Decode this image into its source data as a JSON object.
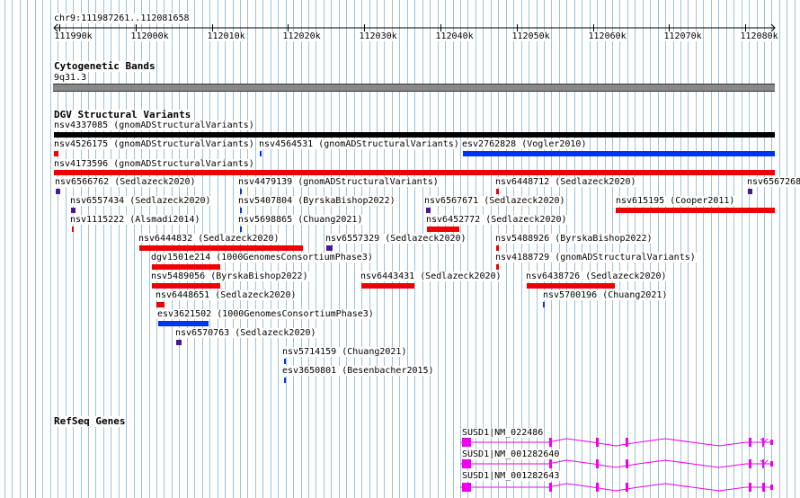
{
  "colors": {
    "grid_line": "#9cc3d8",
    "gnomad": "#000000",
    "deletion": "#ee0000",
    "duplication": "#0033ee",
    "complex": "#4a1a8c",
    "refseq": "#ee00ee",
    "band_gray": "#888888"
  },
  "ruler": {
    "position": "chr9:111987261..112081658",
    "ticks": [
      "111990k",
      "112000k",
      "112010k",
      "112020k",
      "112030k",
      "112040k",
      "112050k",
      "112060k",
      "112070k",
      "112080k"
    ]
  },
  "cytobands": {
    "title": "Cytogenetic Bands",
    "band_label": "9q31.3"
  },
  "dgv": {
    "title": "DGV Structural Variants",
    "features": [
      {
        "label": "nsv4337085 (gnomADStructuralVariants)",
        "kind": "gnomad"
      },
      {
        "label": "nsv4526175 (gnomADStructuralVariants)",
        "kind": "deletion"
      },
      {
        "label": "nsv4564531 (gnomADStructuralVariants)",
        "kind": "duplication"
      },
      {
        "label": "esv2762828 (Vogler2010)",
        "kind": "duplication"
      },
      {
        "label": "nsv4173596 (gnomADStructuralVariants)",
        "kind": "deletion"
      },
      {
        "label": "nsv6566762 (Sedlazeck2020)",
        "kind": "complex"
      },
      {
        "label": "nsv4479139 (gnomADStructuralVariants)",
        "kind": "duplication"
      },
      {
        "label": "nsv6448712 (Sedlazeck2020)",
        "kind": "deletion"
      },
      {
        "label": "nsv6567268",
        "kind": "complex"
      },
      {
        "label": "nsv6557434 (Sedlazeck2020)",
        "kind": "complex"
      },
      {
        "label": "nsv5407804 (ByrskaBishop2022)",
        "kind": "duplication"
      },
      {
        "label": "nsv6567671 (Sedlazeck2020)",
        "kind": "complex"
      },
      {
        "label": "nsv615195 (Cooper2011)",
        "kind": "deletion"
      },
      {
        "label": "nsv1115222 (Alsmadi2014)",
        "kind": "deletion"
      },
      {
        "label": "nsv5698865 (Chuang2021)",
        "kind": "duplication"
      },
      {
        "label": "nsv6452772 (Sedlazeck2020)",
        "kind": "deletion"
      },
      {
        "label": "nsv6444832 (Sedlazeck2020)",
        "kind": "deletion"
      },
      {
        "label": "nsv6557329 (Sedlazeck2020)",
        "kind": "complex"
      },
      {
        "label": "nsv5488926 (ByrskaBishop2022)",
        "kind": "deletion"
      },
      {
        "label": "dgv1501e214 (1000GenomesConsortiumPhase3)",
        "kind": "deletion"
      },
      {
        "label": "nsv4188729 (gnomADStructuralVariants)",
        "kind": "deletion"
      },
      {
        "label": "nsv5489056 (ByrskaBishop2022)",
        "kind": "deletion"
      },
      {
        "label": "nsv6443431 (Sedlazeck2020)",
        "kind": "deletion"
      },
      {
        "label": "nsv6438726 (Sedlazeck2020)",
        "kind": "deletion"
      },
      {
        "label": "nsv6448651 (Sedlazeck2020)",
        "kind": "deletion"
      },
      {
        "label": "nsv5700196 (Chuang2021)",
        "kind": "duplication"
      },
      {
        "label": "esv3621502 (1000GenomesConsortiumPhase3)",
        "kind": "duplication"
      },
      {
        "label": "nsv6570763 (Sedlazeck2020)",
        "kind": "complex"
      },
      {
        "label": "nsv5714159 (Chuang2021)",
        "kind": "duplication"
      },
      {
        "label": "esv3650801 (Besenbacher2015)",
        "kind": "duplication"
      }
    ]
  },
  "refseq": {
    "title": "RefSeq Genes",
    "transcripts": [
      {
        "label": "SUSD1|NM_022486"
      },
      {
        "label": "SUSD1|NM_001282640"
      },
      {
        "label": "SUSD1|NM_001282643"
      }
    ]
  }
}
